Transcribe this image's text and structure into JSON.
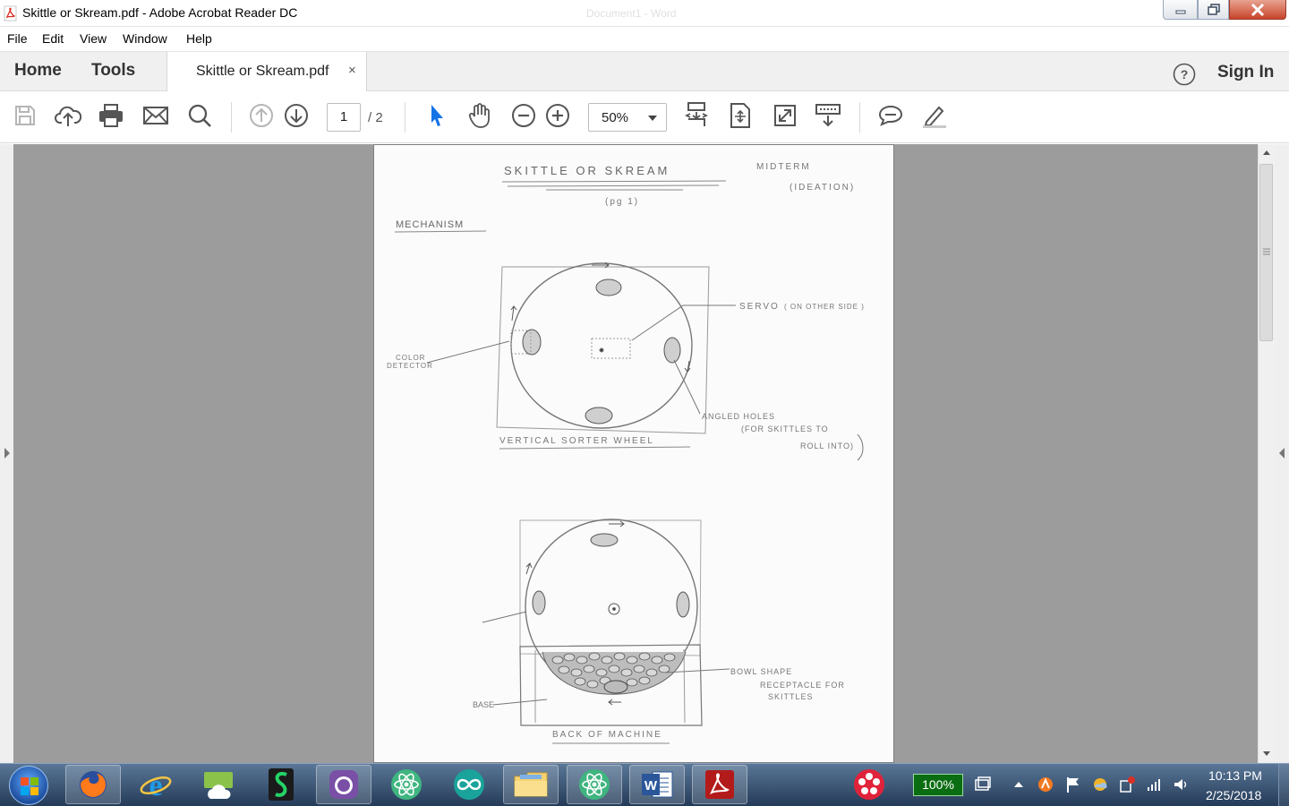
{
  "window": {
    "title": "Skittle or Skream.pdf - Adobe Acrobat Reader DC",
    "background_title": "Document1 - Word"
  },
  "menu": [
    "File",
    "Edit",
    "View",
    "Window",
    "Help"
  ],
  "tabs": {
    "home": "Home",
    "tools": "Tools",
    "document": "Skittle or Skream.pdf",
    "close": "×",
    "sign_in": "Sign In"
  },
  "toolbar": {
    "current_page": "1",
    "page_total": "/ 2",
    "zoom": "50%"
  },
  "document_page": {
    "title": "SKITTLE OR SKREAM",
    "subtitle": "(pg 1)",
    "note_line1": "MIDTERM",
    "note_line2": "(IDEATION)",
    "section": "MECHANISM",
    "label_servo": "SERVO",
    "label_servo_note": "( ON OTHER SIDE )",
    "label_color_line1": "COLOR",
    "label_color_line2": "DETECTOR",
    "label_holes_line1": "ANGLED HOLES",
    "label_holes_line2": "(FOR SKITTLES TO",
    "label_holes_line3": "ROLL INTO)",
    "caption_wheel": "VERTICAL SORTER WHEEL",
    "label_bowl_line1": "BOWL SHAPE",
    "label_bowl_line2": "RECEPTACLE FOR",
    "label_bowl_line3": "SKITTLES",
    "label_base": "BASE",
    "caption_back": "BACK OF MACHINE"
  },
  "taskbar": {
    "battery": "100%",
    "time": "10:13 PM",
    "date": "2/25/2018"
  },
  "colors": {
    "acrobat_red": "#d8261b",
    "select_blue": "#1473e6",
    "canvas_gray": "#9c9c9c"
  }
}
